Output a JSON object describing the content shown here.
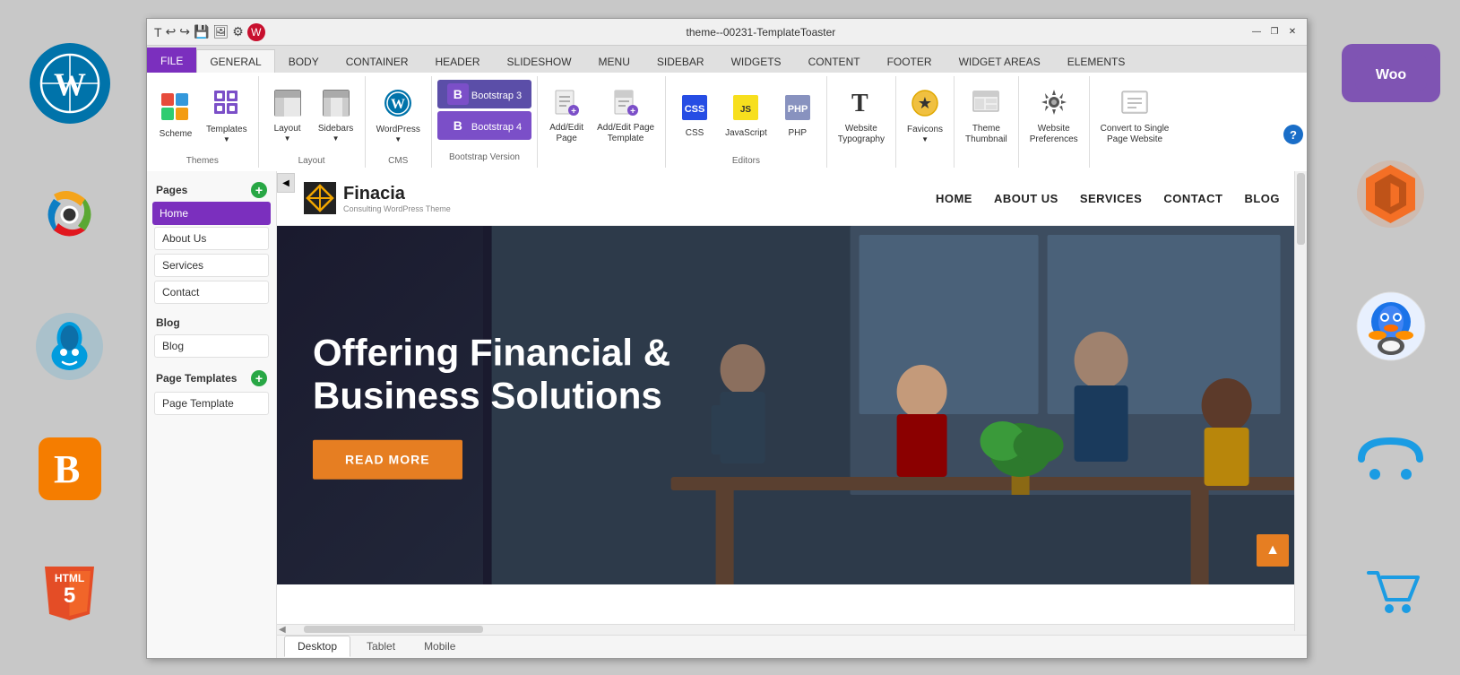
{
  "window": {
    "title": "theme--00231-TemplateToaster",
    "minimize": "—",
    "restore": "❐",
    "close": "✕"
  },
  "ribbon_tabs": [
    {
      "label": "FILE",
      "active": true,
      "style": "purple"
    },
    {
      "label": "GENERAL",
      "active": false
    },
    {
      "label": "BODY",
      "active": false
    },
    {
      "label": "CONTAINER",
      "active": false
    },
    {
      "label": "HEADER",
      "active": false
    },
    {
      "label": "SLIDESHOW",
      "active": false
    },
    {
      "label": "MENU",
      "active": false
    },
    {
      "label": "SIDEBAR",
      "active": false
    },
    {
      "label": "WIDGETS",
      "active": false
    },
    {
      "label": "CONTENT",
      "active": false
    },
    {
      "label": "FOOTER",
      "active": false
    },
    {
      "label": "WIDGET AREAS",
      "active": false
    },
    {
      "label": "ELEMENTS",
      "active": false
    }
  ],
  "ribbon_groups": {
    "themes": {
      "label": "Themes",
      "items": [
        {
          "id": "scheme",
          "label": "Scheme",
          "icon": "🎨"
        },
        {
          "id": "templates",
          "label": "Templates",
          "icon": "📋"
        }
      ]
    },
    "layout": {
      "label": "Layout",
      "items": [
        {
          "id": "layout",
          "label": "Layout",
          "icon": "▦"
        },
        {
          "id": "sidebars",
          "label": "Sidebars",
          "icon": "▣"
        }
      ]
    },
    "cms": {
      "label": "CMS",
      "items": [
        {
          "id": "wordpress",
          "label": "WordPress",
          "icon": "W"
        }
      ]
    },
    "bootstrap": {
      "label": "Bootstrap Version",
      "btns": [
        {
          "label": "Bootstrap 3",
          "active": false
        },
        {
          "label": "Bootstrap 4",
          "active": true
        }
      ]
    },
    "editors": {
      "label": "Editors",
      "items": [
        {
          "id": "add-edit-page",
          "label": "Add/Edit\nPage",
          "icon": "📄"
        },
        {
          "id": "add-edit-page-template",
          "label": "Add/Edit Page\nTemplate",
          "icon": "📝"
        },
        {
          "id": "css",
          "label": "CSS",
          "icon": "CSS"
        },
        {
          "id": "javascript",
          "label": "JavaScript",
          "icon": "JS"
        },
        {
          "id": "php",
          "label": "PHP",
          "icon": "PHP"
        }
      ]
    },
    "website_typography": {
      "label": "Website\nTypography",
      "icon": "T"
    },
    "favicons": {
      "label": "Favicons",
      "icon": "★"
    },
    "theme_thumbnail": {
      "label": "Theme\nThumbnail",
      "icon": "🖼"
    },
    "website_preferences": {
      "label": "Website\nPreferences",
      "icon": "⚙"
    },
    "convert": {
      "label": "Convert to Single\nPage Website",
      "icon": "🔄"
    }
  },
  "sidebar": {
    "pages_section": "Pages",
    "pages_items": [
      {
        "label": "Home",
        "active": true
      },
      {
        "label": "About Us",
        "active": false
      },
      {
        "label": "Services",
        "active": false
      },
      {
        "label": "Contact",
        "active": false
      }
    ],
    "blog_section": "Blog",
    "blog_items": [
      {
        "label": "Blog",
        "active": false
      }
    ],
    "page_templates_section": "Page Templates",
    "page_template_items": [
      {
        "label": "Page Template",
        "active": false
      }
    ]
  },
  "site": {
    "logo_name": "Finacia",
    "logo_tagline": "Consulting WordPress Theme",
    "nav_items": [
      "HOME",
      "ABOUT US",
      "SERVICES",
      "CONTACT",
      "BLOG"
    ],
    "hero_title": "Offering Financial &\nBusiness Solutions",
    "hero_btn": "READ MORE"
  },
  "bottom_tabs": [
    {
      "label": "Desktop",
      "active": true
    },
    {
      "label": "Tablet",
      "active": false
    },
    {
      "label": "Mobile",
      "active": false
    }
  ],
  "side_icons_left": [
    {
      "id": "wordpress",
      "label": "WordPress"
    },
    {
      "id": "joomla",
      "label": "Joomla"
    },
    {
      "id": "drupal",
      "label": "Drupal"
    },
    {
      "id": "blogger",
      "label": "Blogger"
    },
    {
      "id": "html5",
      "label": "HTML5"
    }
  ],
  "side_icons_right": [
    {
      "id": "woocommerce",
      "label": "WooCommerce"
    },
    {
      "id": "magento",
      "label": "Magento"
    },
    {
      "id": "puffin",
      "label": "Puffin Browser"
    },
    {
      "id": "opencart",
      "label": "OpenCart"
    },
    {
      "id": "cart",
      "label": "Shopping Cart"
    }
  ]
}
